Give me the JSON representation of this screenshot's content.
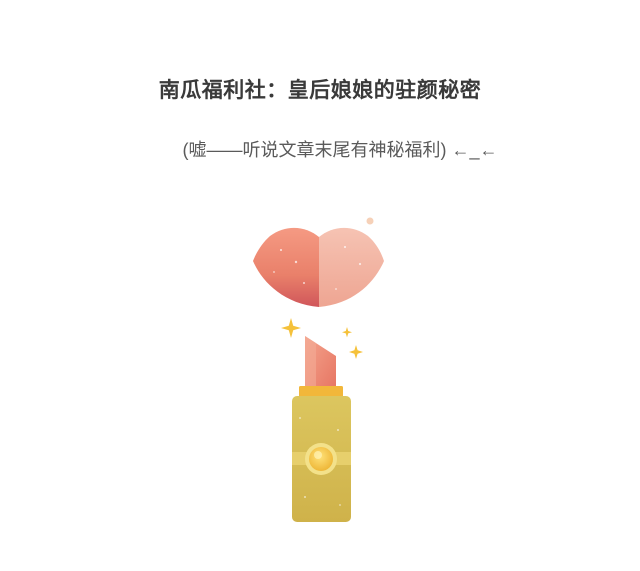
{
  "article": {
    "title": "南瓜福利社：皇后娘娘的驻颜秘密",
    "subtitle": "(嘘——听说文章末尾有神秘福利) ←_←"
  },
  "illustration": {
    "icons": [
      "lips-icon",
      "lipstick-icon",
      "sparkle-icon",
      "dot-icon"
    ],
    "colors": {
      "lips_left": "#ee8a74",
      "lips_right": "#f3b8a6",
      "lipstick_bullet": "#ef8e78",
      "lipstick_collar": "#f2b73a",
      "lipstick_body": "#d9c25a",
      "lipstick_band": "#e7cf6c",
      "button": "#f6cf57",
      "sparkle": "#f5c13a",
      "dot": "#f6d1b8"
    }
  }
}
